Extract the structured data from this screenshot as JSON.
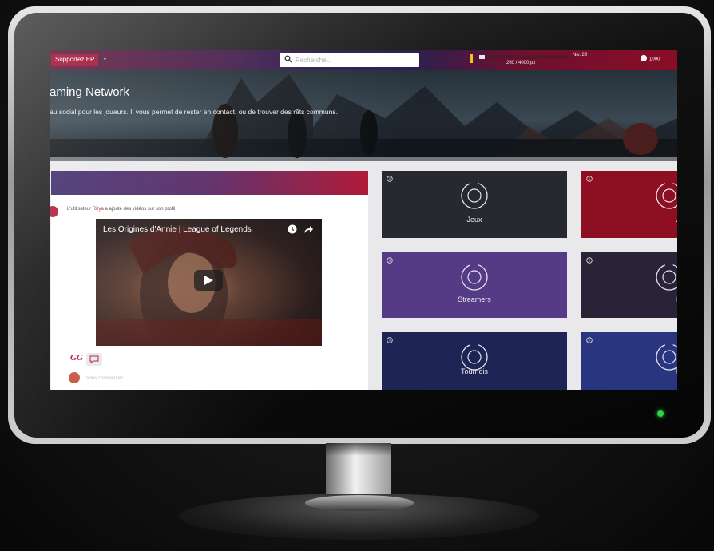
{
  "topbar": {
    "support_button": "Supportez EP",
    "search_placeholder": "Recherche...",
    "xp_level": "Niv. 29",
    "xp_progress_text": "260 / 4000 px",
    "xp_progress_fraction": 0.065,
    "coins": "1000"
  },
  "hero": {
    "title": "aming Network",
    "description": "au social pour les joueurs. Il vous permet de rester en contact, ou de trouver des rêts communs."
  },
  "feed": {
    "post_prefix": "L'utilisateur ",
    "post_user": "Rirya",
    "post_suffix": " a ajouté des vidéos sur son profil !",
    "video_title": "Les Origines d'Annie | League of Legends",
    "logo_text": "GG",
    "comment_placeholder": "Vous commentez..."
  },
  "tiles": [
    {
      "label": "Jeux",
      "color": "#262a30",
      "icon": "gamepad-icon"
    },
    {
      "label": "Joue",
      "color": "#8e0e22",
      "icon": "player-icon"
    },
    {
      "label": "Streamers",
      "color": "#553b86",
      "icon": "camera-icon"
    },
    {
      "label": "Equi",
      "color": "#2a2338",
      "icon": "team-icon"
    },
    {
      "label": "Tournois",
      "color": "#1e2453",
      "icon": "trophy-icon"
    },
    {
      "label": "Pseu",
      "color": "#2a3580",
      "icon": "pseudo-icon"
    }
  ],
  "colors": {
    "accent": "#b01a38",
    "power_led": "#2dd34a"
  }
}
